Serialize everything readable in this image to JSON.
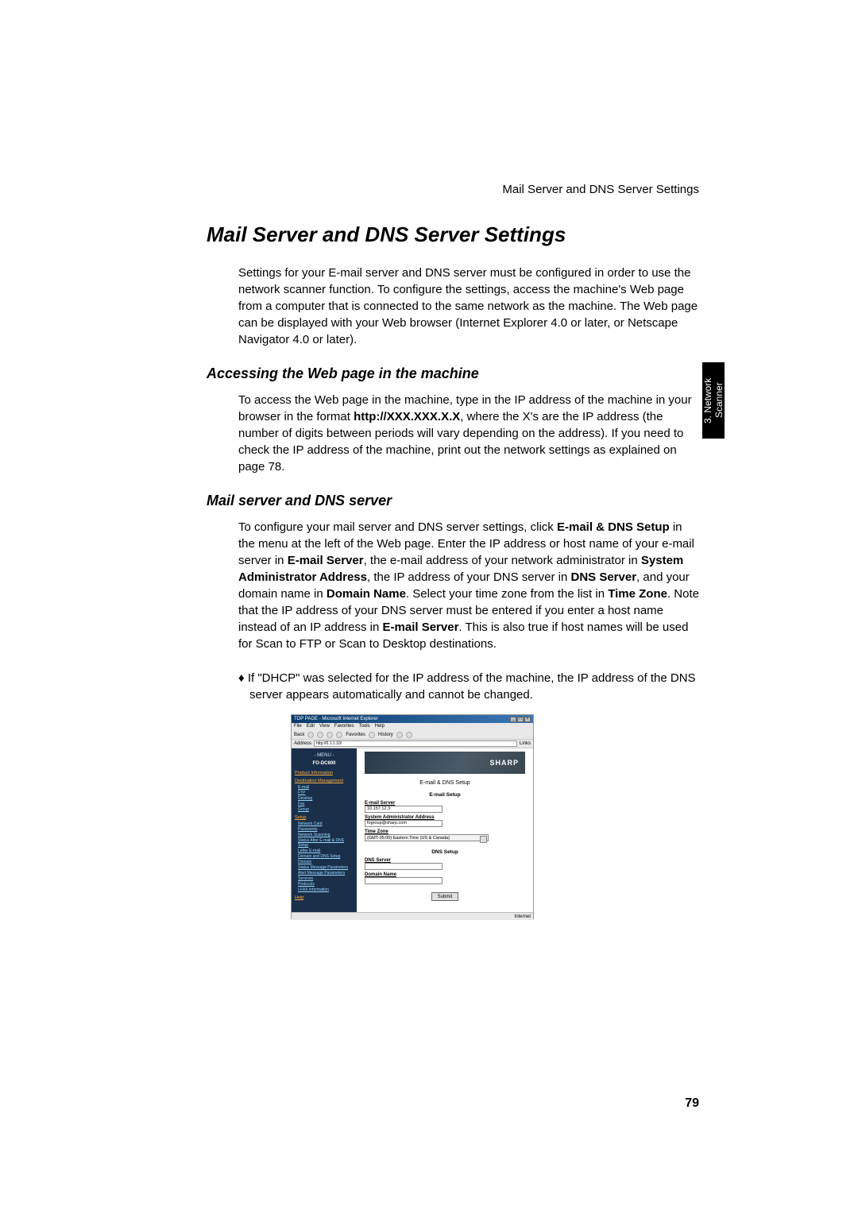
{
  "header_right": "Mail Server and DNS Server Settings",
  "title": "Mail Server and DNS Server Settings",
  "intro": "Settings for your E-mail server and DNS server must be configured in order to use the network scanner function. To configure the settings, access the machine's Web page from a computer that is connected to the same network as the machine. The Web page can be displayed with your Web browser (Internet Explorer 4.0 or later, or Netscape Navigator 4.0 or later).",
  "side_tab": "3. Network Scanner",
  "sections": [
    {
      "heading": "Accessing the Web page in the machine",
      "body_parts": [
        "To access the Web page in the machine, type in the IP address of the machine in your browser in the format ",
        "http://XXX.XXX.X.X",
        ", where the X's are the IP address (the number of digits between periods will vary depending on the address). If you need to check the IP address of the machine, print out the network settings as explained on page 78."
      ]
    },
    {
      "heading": "Mail server and DNS server",
      "body_parts": [
        "To configure your mail server and DNS server settings, click ",
        "E-mail & DNS Setup",
        " in the menu at the left of the Web page. Enter the IP address or host name of your e-mail server in ",
        "E-mail Server",
        ", the e-mail address of your network administrator in ",
        "System Administrator Address",
        ", the IP address of your DNS server in ",
        "DNS Server",
        ", and your domain name in ",
        "Domain Name",
        ". Select your time zone from the list in ",
        "Time Zone",
        ". Note that the IP address of your DNS server must be entered if you enter a host name instead of an IP address in ",
        "E-mail Server",
        ". This is also true if host names will be used for Scan to FTP or Scan to Desktop destinations."
      ]
    }
  ],
  "bullet": "If \"DHCP\" was selected for the IP address of the machine, the IP address of the DNS server appears automatically and cannot be changed.",
  "screenshot": {
    "window_title": "TOP PAGE - Microsoft Internet Explorer",
    "menu_items": [
      "File",
      "Edit",
      "View",
      "Favorites",
      "Tools",
      "Help"
    ],
    "toolbar_items": [
      "Back",
      "Favorites",
      "History"
    ],
    "address_label": "Address",
    "address_value": "http://0.1.1.10/",
    "links_label": "Links",
    "sidebar": {
      "menu_label": "- MENU -",
      "model": "FO-DC600",
      "product_info": "Product Information",
      "dest_mgmt": "Destination Management",
      "dest_items": [
        "E-mail",
        "FTP",
        "Desktop",
        "Fax",
        "Group"
      ],
      "setup_label": "Setup",
      "setup_items": [
        "Network Card",
        "Passwords",
        "Network Scanning",
        "Status After E-mail & DNS Setup",
        "Letter E-mail",
        "Domain and DNS Setup",
        "Domain",
        "Status Message Parameters",
        "Alert Message Parameters",
        "Services",
        "Protocols",
        "I-FAX    Information"
      ],
      "help_label": "Help"
    },
    "main": {
      "brand": "SHARP",
      "page_title": "E-mail & DNS Setup",
      "email_setup_label": "E-mail Setup",
      "email_server_label": "E-mail Server",
      "email_server_value": "10.157.12.3",
      "sysadmin_label": "System Administrator Address",
      "sysadmin_value": "fogroup@sharp.com",
      "timezone_label": "Time Zone",
      "timezone_value": "(GMT-05:00) Eastern Time (US & Canada)",
      "dns_setup_label": "DNS Setup",
      "dns_server_label": "DNS Server",
      "domain_name_label": "Domain Name",
      "submit_label": "Submit"
    },
    "status_right": "Internet"
  },
  "page_number": "79"
}
